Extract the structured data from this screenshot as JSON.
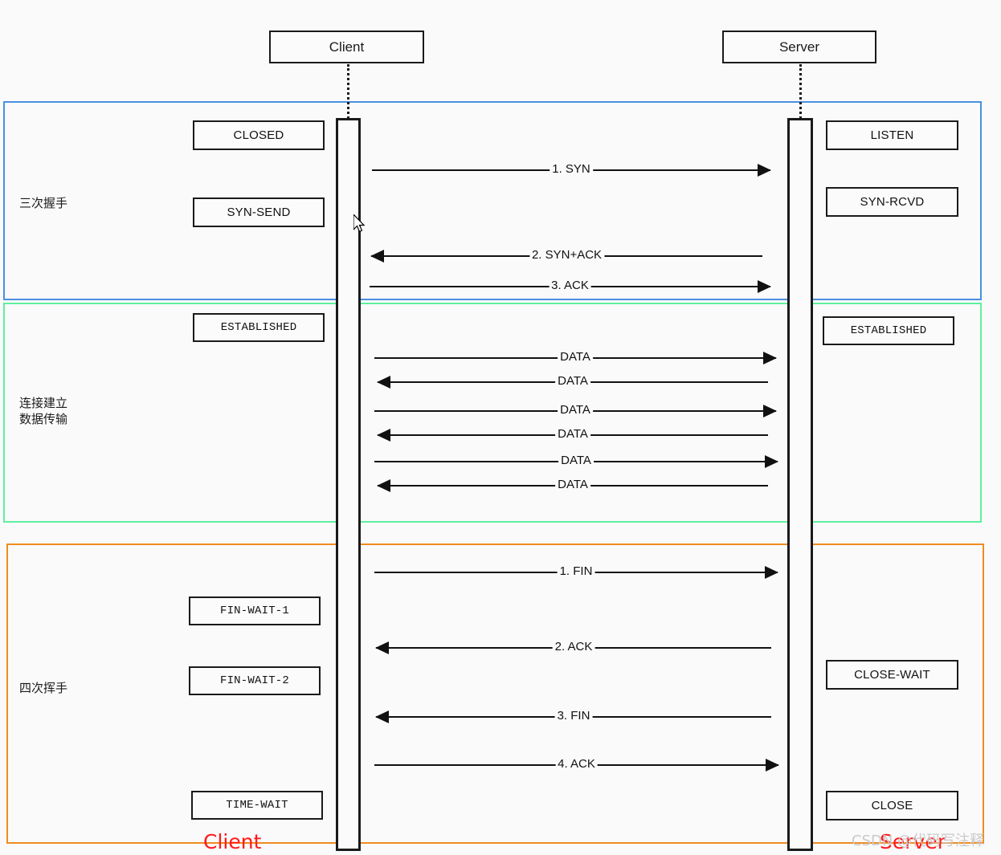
{
  "diagram": {
    "title_actors": [
      {
        "name": "Client",
        "label": "Client"
      },
      {
        "name": "Server",
        "label": "Server"
      }
    ],
    "sections": [
      {
        "key": "handshake",
        "label": "三次握手",
        "color": "#4a90e2"
      },
      {
        "key": "established",
        "label": "连接建立\n数据传输",
        "color": "#5ef0a0"
      },
      {
        "key": "teardown",
        "label": "四次挥手",
        "color": "#f08c1e"
      }
    ],
    "client_states": [
      {
        "label": "CLOSED"
      },
      {
        "label": "SYN-SEND"
      },
      {
        "label": "ESTABLISHED"
      },
      {
        "label": "FIN-WAIT-1"
      },
      {
        "label": "FIN-WAIT-2"
      },
      {
        "label": "TIME-WAIT"
      }
    ],
    "server_states": [
      {
        "label": "LISTEN"
      },
      {
        "label": "SYN-RCVD"
      },
      {
        "label": "ESTABLISHED"
      },
      {
        "label": "CLOSE-WAIT"
      },
      {
        "label": "CLOSE"
      }
    ],
    "messages": [
      {
        "label": "1. SYN",
        "direction": "right"
      },
      {
        "label": "2. SYN+ACK",
        "direction": "left"
      },
      {
        "label": "3. ACK",
        "direction": "right"
      },
      {
        "label": "DATA",
        "direction": "right"
      },
      {
        "label": "DATA",
        "direction": "left"
      },
      {
        "label": "DATA",
        "direction": "right"
      },
      {
        "label": "DATA",
        "direction": "left"
      },
      {
        "label": "DATA",
        "direction": "right"
      },
      {
        "label": "DATA",
        "direction": "left"
      },
      {
        "label": "1. FIN",
        "direction": "right"
      },
      {
        "label": "2. ACK",
        "direction": "left"
      },
      {
        "label": "3. FIN",
        "direction": "left"
      },
      {
        "label": "4. ACK",
        "direction": "right"
      }
    ],
    "footer_labels": [
      {
        "label": "Client",
        "color": "#ff1a1a"
      },
      {
        "label": "Server",
        "color": "#ff1a1a"
      }
    ],
    "watermark": "CSDN @代码写注释"
  }
}
